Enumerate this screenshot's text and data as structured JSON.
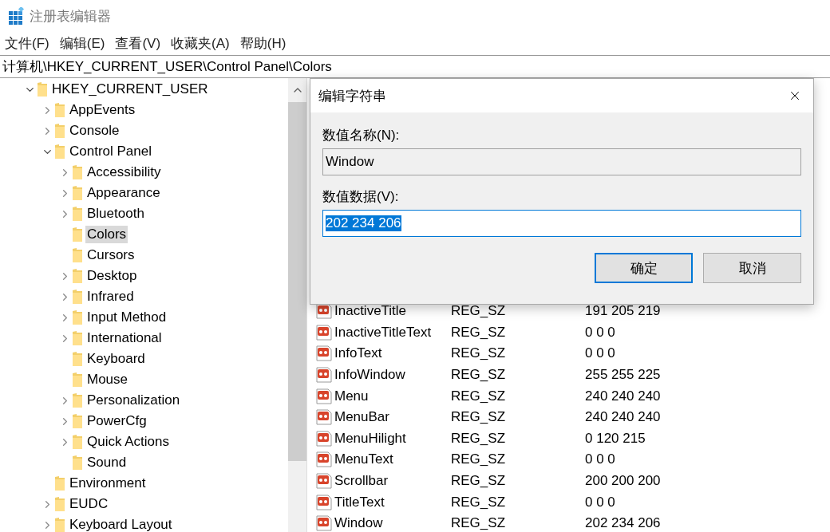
{
  "window": {
    "title": "注册表编辑器"
  },
  "menu": [
    {
      "label": "文件(F)"
    },
    {
      "label": "编辑(E)"
    },
    {
      "label": "查看(V)"
    },
    {
      "label": "收藏夹(A)"
    },
    {
      "label": "帮助(H)"
    }
  ],
  "address": "计算机\\HKEY_CURRENT_USER\\Control Panel\\Colors",
  "tree": [
    {
      "label": "HKEY_CURRENT_USER",
      "kind": "branch",
      "expanded": true,
      "selected": false,
      "children": [
        {
          "label": "AppEvents",
          "kind": "branch",
          "expanded": false,
          "selected": false
        },
        {
          "label": "Console",
          "kind": "branch",
          "expanded": false,
          "selected": false
        },
        {
          "label": "Control Panel",
          "kind": "branch",
          "expanded": true,
          "selected": false,
          "children": [
            {
              "label": "Accessibility",
              "kind": "branch",
              "expanded": false,
              "selected": false
            },
            {
              "label": "Appearance",
              "kind": "branch",
              "expanded": false,
              "selected": false
            },
            {
              "label": "Bluetooth",
              "kind": "branch",
              "expanded": false,
              "selected": false
            },
            {
              "label": "Colors",
              "kind": "leaf",
              "selected": true
            },
            {
              "label": "Cursors",
              "kind": "leaf",
              "selected": false
            },
            {
              "label": "Desktop",
              "kind": "branch",
              "expanded": false,
              "selected": false
            },
            {
              "label": "Infrared",
              "kind": "branch",
              "expanded": false,
              "selected": false
            },
            {
              "label": "Input Method",
              "kind": "branch",
              "expanded": false,
              "selected": false
            },
            {
              "label": "International",
              "kind": "branch",
              "expanded": false,
              "selected": false
            },
            {
              "label": "Keyboard",
              "kind": "leaf",
              "selected": false
            },
            {
              "label": "Mouse",
              "kind": "leaf",
              "selected": false
            },
            {
              "label": "Personalization",
              "kind": "branch",
              "expanded": false,
              "selected": false
            },
            {
              "label": "PowerCfg",
              "kind": "branch",
              "expanded": false,
              "selected": false
            },
            {
              "label": "Quick Actions",
              "kind": "branch",
              "expanded": false,
              "selected": false
            },
            {
              "label": "Sound",
              "kind": "leaf",
              "selected": false
            }
          ]
        },
        {
          "label": "Environment",
          "kind": "leaf",
          "selected": false
        },
        {
          "label": "EUDC",
          "kind": "branch",
          "expanded": false,
          "selected": false
        },
        {
          "label": "Keyboard Layout",
          "kind": "branch",
          "expanded": false,
          "selected": false
        }
      ]
    }
  ],
  "values": [
    {
      "name": "InactiveTitle",
      "type": "REG_SZ",
      "data": "191 205 219"
    },
    {
      "name": "InactiveTitleText",
      "type": "REG_SZ",
      "data": "0 0 0"
    },
    {
      "name": "InfoText",
      "type": "REG_SZ",
      "data": "0 0 0"
    },
    {
      "name": "InfoWindow",
      "type": "REG_SZ",
      "data": "255 255 225"
    },
    {
      "name": "Menu",
      "type": "REG_SZ",
      "data": "240 240 240"
    },
    {
      "name": "MenuBar",
      "type": "REG_SZ",
      "data": "240 240 240"
    },
    {
      "name": "MenuHilight",
      "type": "REG_SZ",
      "data": "0 120 215"
    },
    {
      "name": "MenuText",
      "type": "REG_SZ",
      "data": "0 0 0"
    },
    {
      "name": "Scrollbar",
      "type": "REG_SZ",
      "data": "200 200 200"
    },
    {
      "name": "TitleText",
      "type": "REG_SZ",
      "data": "0 0 0"
    },
    {
      "name": "Window",
      "type": "REG_SZ",
      "data": "202 234 206"
    }
  ],
  "dialog": {
    "title": "编辑字符串",
    "name_label": "数值名称(N):",
    "name_value": "Window",
    "data_label": "数值数据(V):",
    "data_value": "202 234 206",
    "data_selected": true,
    "buttons": [
      {
        "label": "确定",
        "default": true
      },
      {
        "label": "取消",
        "default": false
      }
    ]
  }
}
